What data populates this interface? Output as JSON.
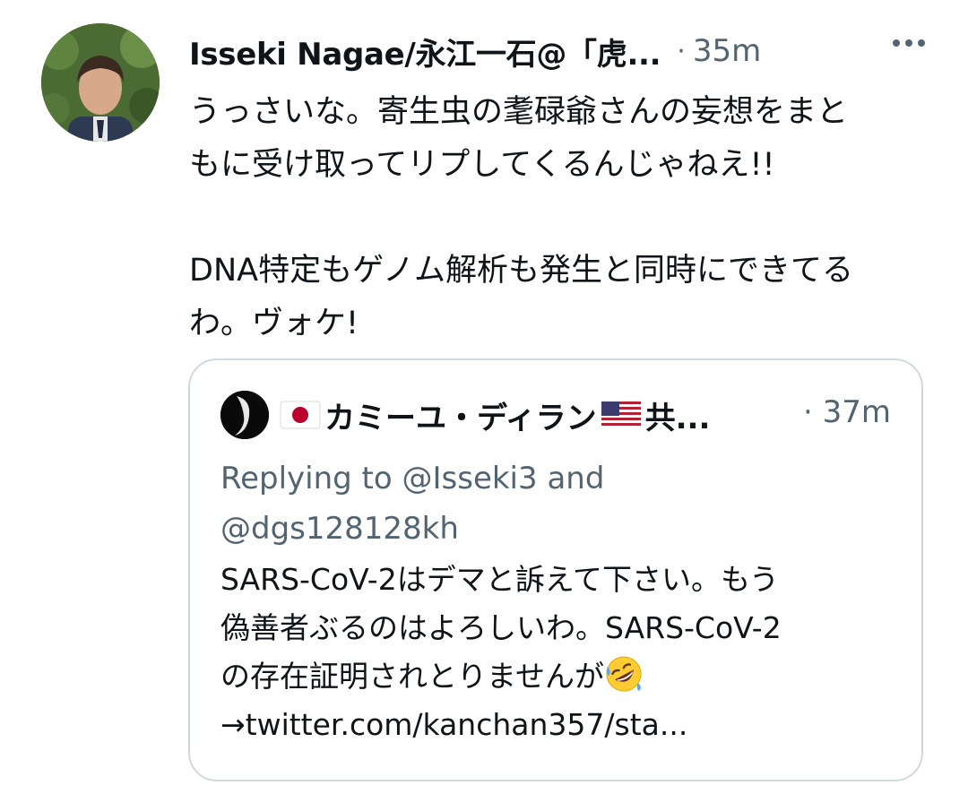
{
  "tweet": {
    "author_name": "Isseki Nagae/永江一石@「虎...",
    "separator": "·",
    "time": "35m",
    "more_icon": "more-horizontal-icon",
    "text_lines_1": [
      "うっさいな。寄生虫の耄碌爺さんの妄想をまと",
      "もに受け取ってリプしてくるんじゃねえ!!"
    ],
    "text_lines_2": [
      "DNA特定もゲノム解析も発生と同時にできてる",
      "わ。ヴォケ!"
    ]
  },
  "quote": {
    "author_name": "カミーユ・ディラン",
    "author_suffix": "共...",
    "flag_left": "japan-flag-icon",
    "flag_right": "us-flag-icon",
    "separator": "·",
    "time": "37m",
    "reply_line_1": "Replying to @Isseki3 and",
    "reply_line_2": "@dgs128128kh",
    "text_line_1": "SARS-CoV-2はデマと訴えて下さい。もう",
    "text_line_2": "偽善者ぶるのはよろしいわ。SARS-CoV-2",
    "text_line_3": "の存在証明されとりませんが",
    "text_line_4": "→twitter.com/kanchan357/sta...",
    "emoji": "rolling-on-floor-laughing-icon"
  },
  "colors": {
    "text_primary": "#0f1419",
    "text_secondary": "#536471",
    "border": "#cfd9de",
    "japan_red": "#bc002d",
    "us_red": "#b22234",
    "us_blue": "#3c3b6e"
  }
}
